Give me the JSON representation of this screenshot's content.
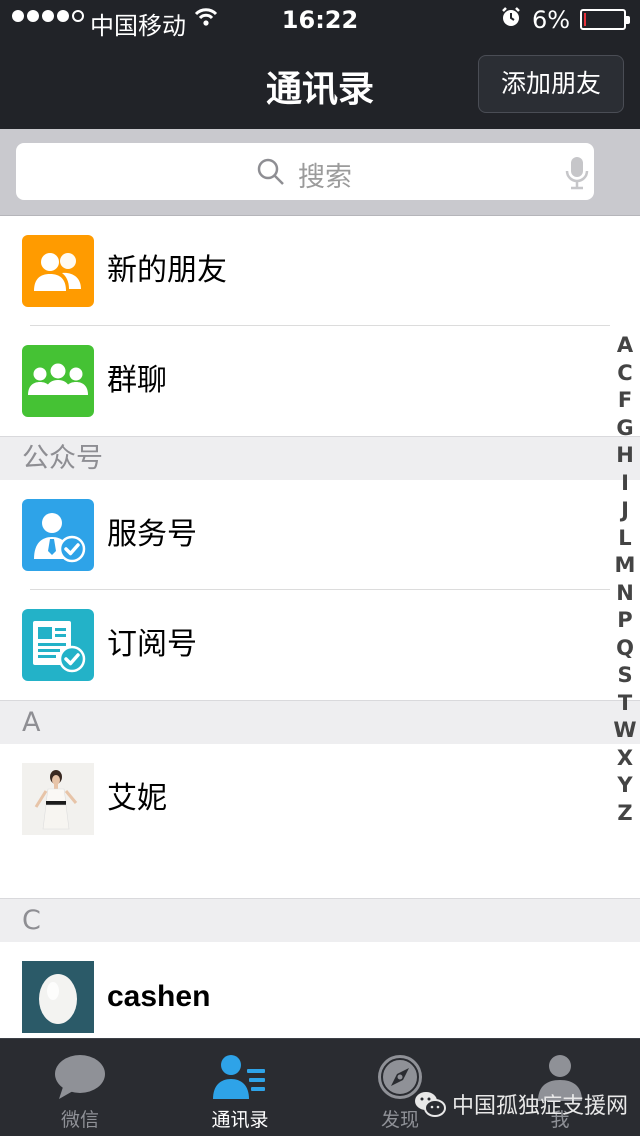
{
  "status_bar": {
    "carrier": "中国移动",
    "time": "16:22",
    "battery_percent": "6%",
    "battery_level": 0.06,
    "signal_bars_filled": 4,
    "signal_bars_total": 5
  },
  "nav": {
    "title": "通讯录",
    "add_friend_label": "添加朋友"
  },
  "search": {
    "placeholder": "搜索"
  },
  "fixed_items": [
    {
      "label": "新的朋友",
      "icon": "new-friends-icon",
      "color": "#ff9b00"
    },
    {
      "label": "群聊",
      "icon": "group-chat-icon",
      "color": "#45c234"
    }
  ],
  "sections": {
    "official": {
      "header": "公众号",
      "items": [
        {
          "label": "服务号",
          "icon": "service-account-icon",
          "color": "#2ea3e8"
        },
        {
          "label": "订阅号",
          "icon": "subscription-account-icon",
          "color": "#23b2c8"
        }
      ]
    },
    "a": {
      "header": "A",
      "items": [
        {
          "label": "艾妮",
          "icon": "avatar-photo"
        }
      ]
    },
    "c": {
      "header": "C",
      "items": [
        {
          "label": "cashen",
          "icon": "egg-avatar"
        }
      ]
    }
  },
  "index_letters": [
    "A",
    "C",
    "F",
    "G",
    "H",
    "I",
    "J",
    "L",
    "M",
    "N",
    "P",
    "Q",
    "S",
    "T",
    "W",
    "X",
    "Y",
    "Z"
  ],
  "tabs": [
    {
      "label": "微信",
      "icon": "chat-bubble-icon",
      "active": false
    },
    {
      "label": "通讯录",
      "icon": "contacts-icon",
      "active": true
    },
    {
      "label": "发现",
      "icon": "compass-icon",
      "active": false
    },
    {
      "label": "我",
      "icon": "profile-icon",
      "active": false
    }
  ],
  "watermark": "中国孤独症支援网",
  "colors": {
    "nav_background": "#212328",
    "tab_active": "#ffffff",
    "contacts_icon": "#2ea3e8"
  }
}
